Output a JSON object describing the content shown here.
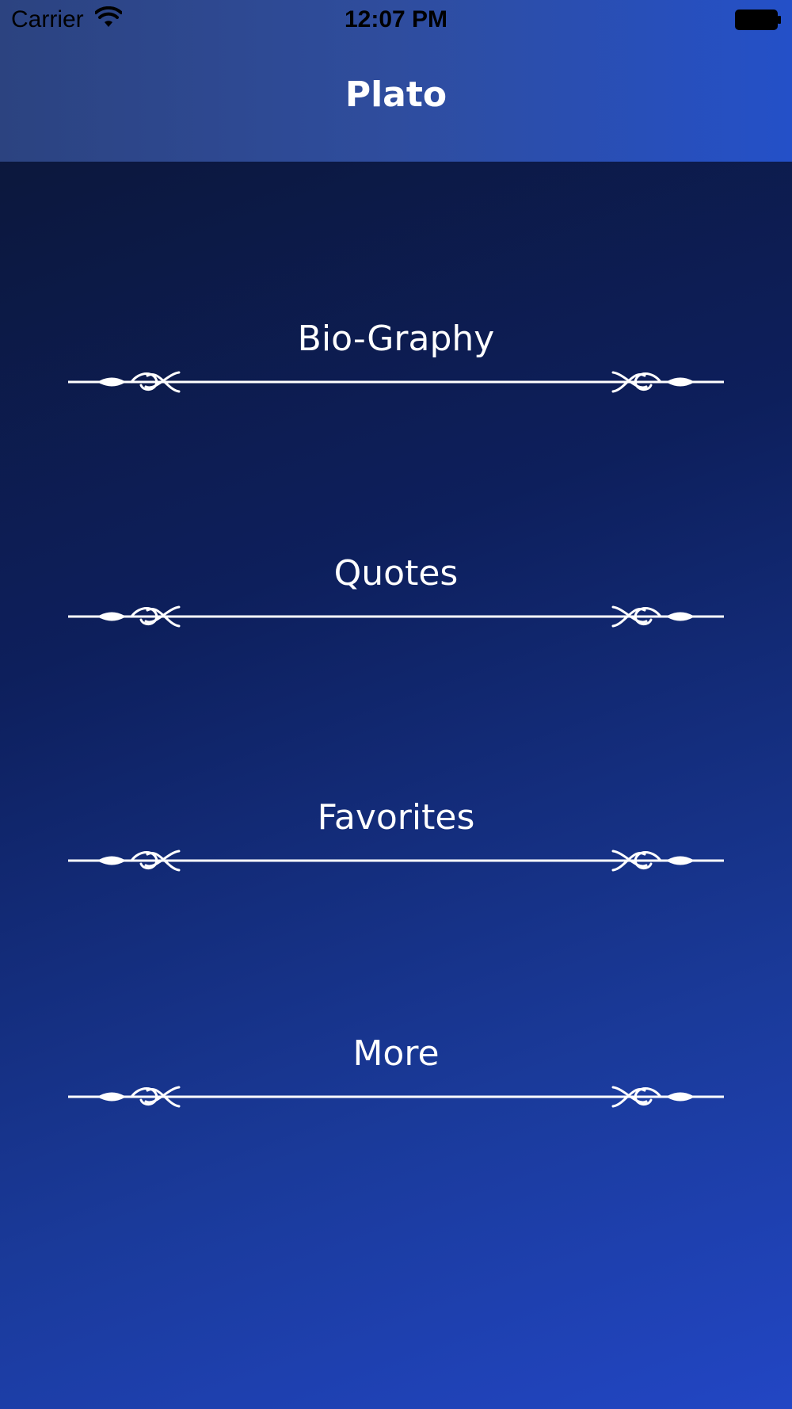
{
  "status_bar": {
    "carrier": "Carrier",
    "time": "12:07 PM",
    "wifi_icon": "wifi-icon",
    "battery_icon": "battery-icon"
  },
  "nav": {
    "title": "Plato"
  },
  "menu": {
    "items": [
      {
        "label": "Bio-Graphy"
      },
      {
        "label": "Quotes"
      },
      {
        "label": "Favorites"
      },
      {
        "label": "More"
      }
    ],
    "divider_icon": "ornamental-divider-icon"
  },
  "colors": {
    "background_top": "#0c1533",
    "background_bottom": "#2246c4",
    "nav_bar": "#2f4d9e",
    "text": "#ffffff"
  }
}
